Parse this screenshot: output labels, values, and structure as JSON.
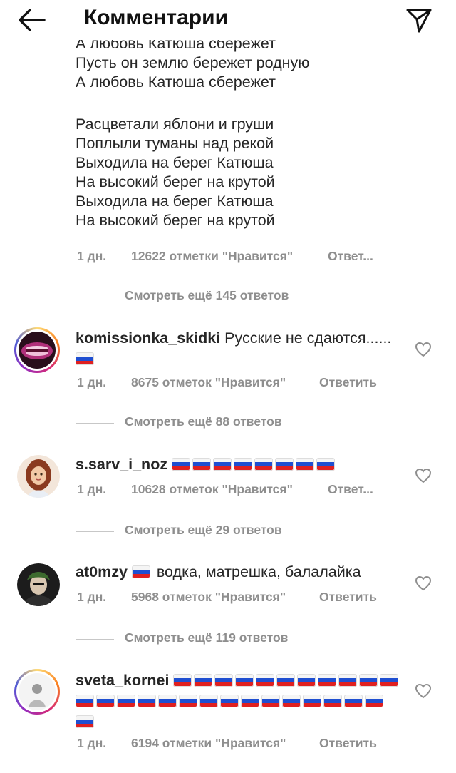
{
  "header": {
    "title": "Комментарии",
    "back_icon": "arrow-left-icon",
    "send_icon": "paper-plane-icon"
  },
  "lyrics": {
    "clipped_line": "А любовь Катюша сбережет",
    "stanza1": [
      "Пусть он землю бережет родную",
      "А любовь Катюша сбережет"
    ],
    "stanza2": [
      "Расцветали яблони и груши",
      "Поплыли туманы над рекой",
      "Выходила на берег Катюша",
      "На высокий берег на крутой",
      "Выходила на берег Катюша",
      "На высокий берег на крутой"
    ],
    "meta": {
      "date": "1 дн.",
      "likes": "12622 отметки \"Нравится\"",
      "reply": "Ответ..."
    },
    "view_more": "Смотреть ещё 145 ответов"
  },
  "comments": [
    {
      "username": "komissionka_skidki",
      "text": "Русские не сдаются......",
      "flags": 1,
      "date": "1 дн.",
      "likes": "8675 отметок \"Нравится\"",
      "reply": "Ответить",
      "view_more": "Смотреть ещё 88 ответов"
    },
    {
      "username": "s.sarv_i_noz",
      "text": "",
      "flags": 8,
      "date": "1 дн.",
      "likes": "10628 отметок \"Нравится\"",
      "reply": "Ответ...",
      "view_more": "Смотреть ещё 29 ответов"
    },
    {
      "username": "at0mzy",
      "text": "водка, матрешка, балалайка",
      "flags": 1,
      "date": "1 дн.",
      "likes": "5968 отметок \"Нравится\"",
      "reply": "Ответить",
      "view_more": "Смотреть ещё 119 ответов"
    },
    {
      "username": "sveta_kornei",
      "text": "",
      "flags": 27,
      "date": "1 дн.",
      "likes": "6194 отметки \"Нравится\"",
      "reply": "Ответить"
    }
  ],
  "colors": {
    "text": "#262626",
    "secondary": "#8e8e8e",
    "flag_white": "#f5f5f5",
    "flag_blue": "#1f4fd1",
    "flag_red": "#e02020"
  }
}
